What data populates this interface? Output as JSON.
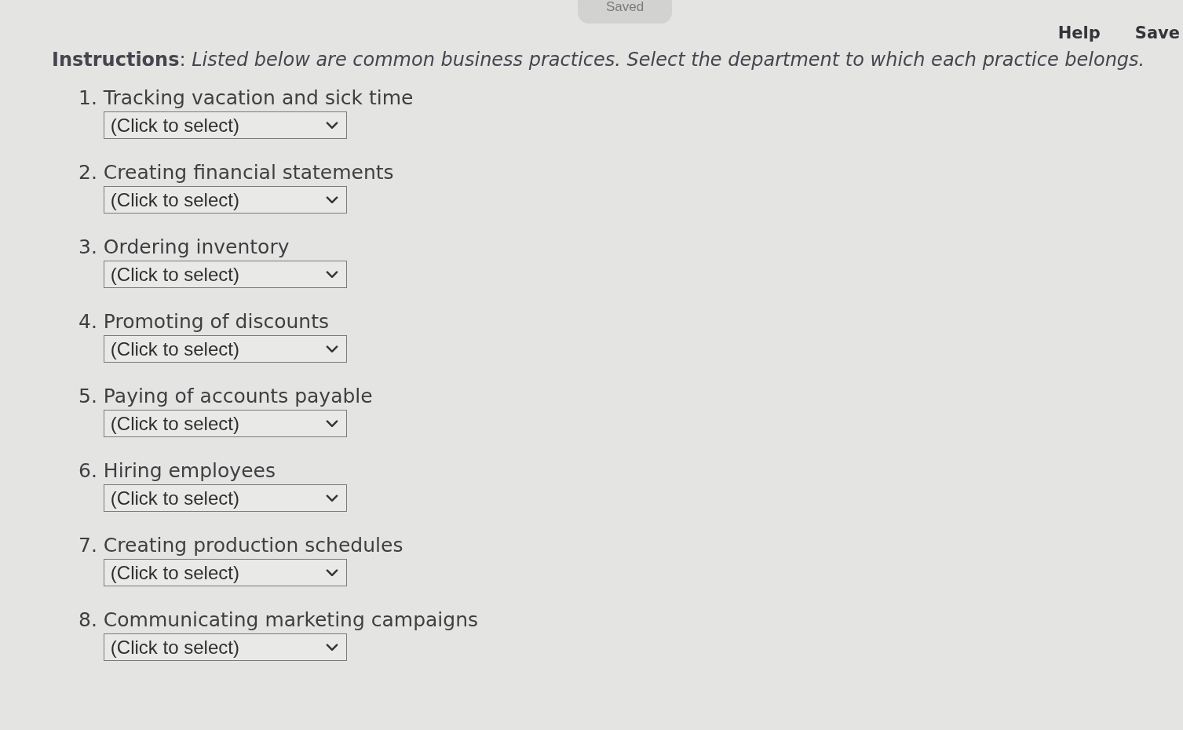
{
  "status_badge": {
    "label": "Saved"
  },
  "header_links": [
    {
      "label": "Help"
    },
    {
      "label": "Save"
    }
  ],
  "instructions": {
    "text": "**Instructions**: *Listed below are common business practices. Select the department to which each practice belongs.*"
  },
  "questions": [
    {
      "number": "1.",
      "text": "Tracking vacation and sick time",
      "select": {
        "value": "(Click to select)"
      }
    },
    {
      "number": "2.",
      "text": "Creating financial statements",
      "select": {
        "value": "(Click to select)"
      }
    },
    {
      "number": "3.",
      "text": "Ordering inventory",
      "select": {
        "value": "(Click to select)"
      }
    },
    {
      "number": "4.",
      "text": "Promoting of discounts",
      "select": {
        "value": "(Click to select)"
      }
    },
    {
      "number": "5.",
      "text": "Paying of accounts payable",
      "select": {
        "value": "(Click to select)"
      }
    },
    {
      "number": "6.",
      "text": "Hiring employees",
      "select": {
        "value": "(Click to select)"
      }
    },
    {
      "number": "7.",
      "text": "Creating production schedules",
      "select": {
        "value": "(Click to select)"
      }
    },
    {
      "number": "8.",
      "text": "Communicating marketing campaigns",
      "select": {
        "value": "(Click to select)"
      }
    }
  ]
}
